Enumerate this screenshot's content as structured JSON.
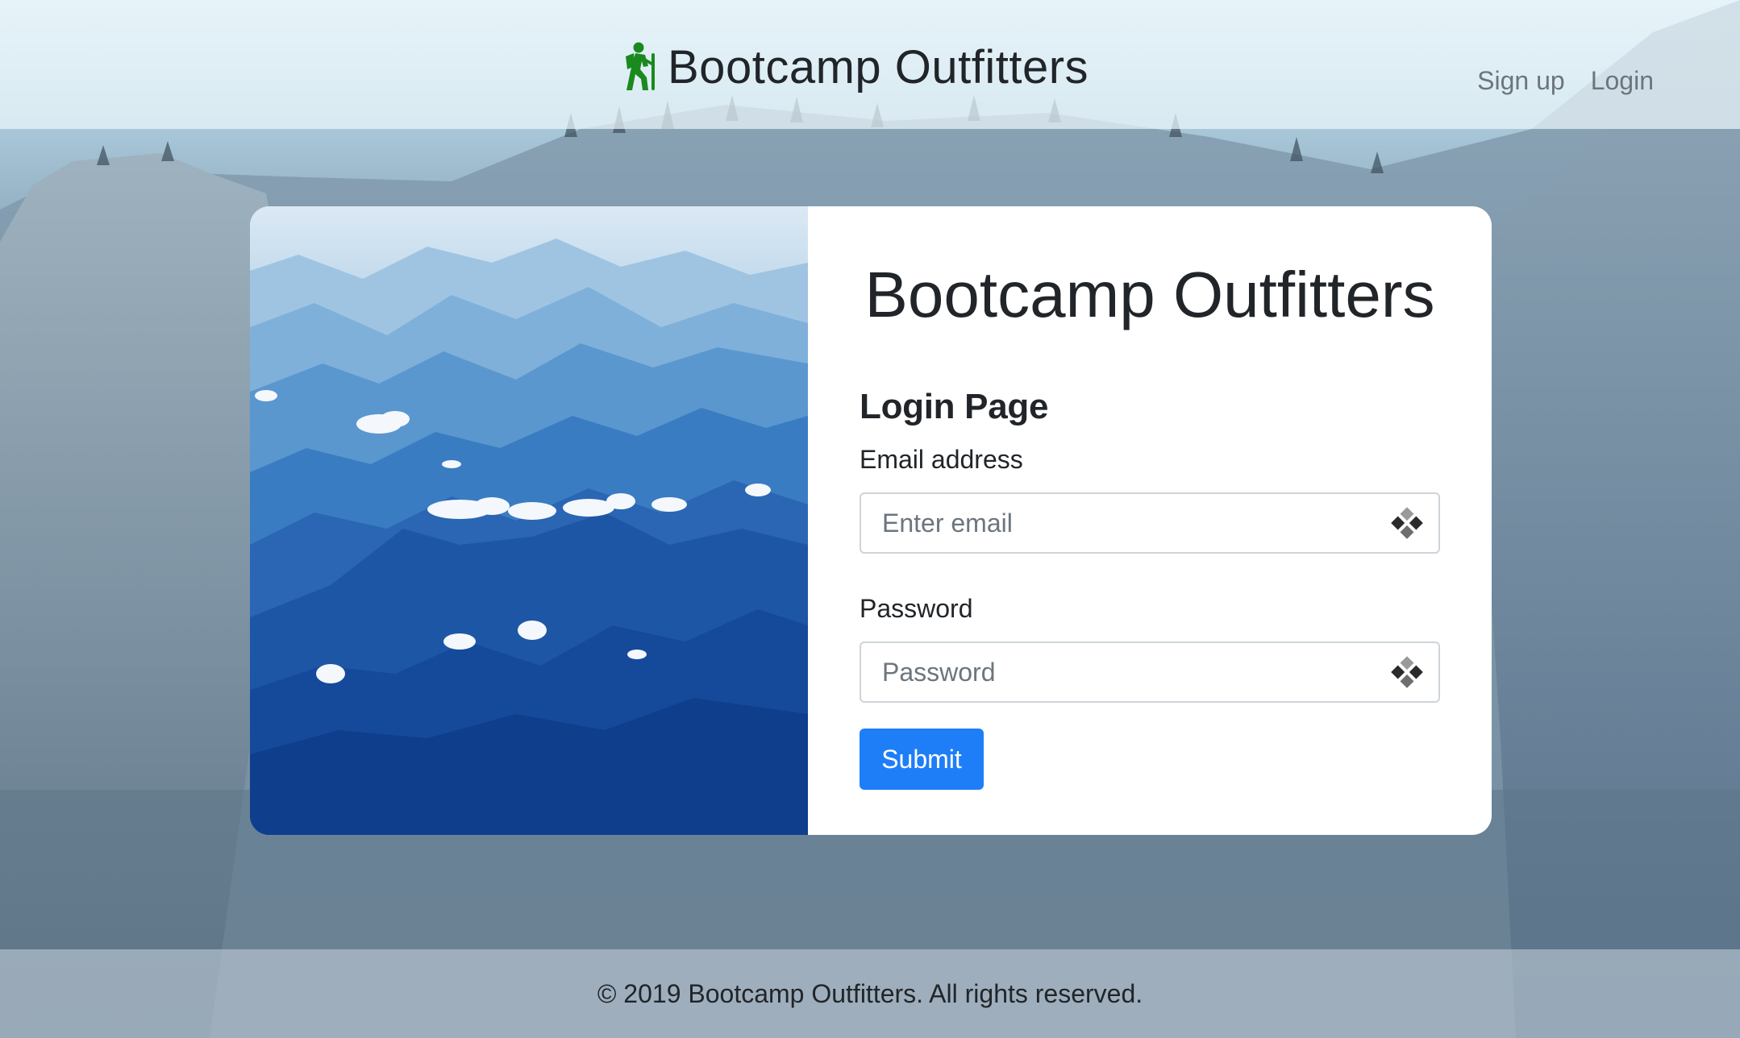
{
  "navbar": {
    "brand": "Bootcamp Outfitters",
    "brand_icon": "hiking-icon",
    "brand_icon_color": "#1a8a1f",
    "links": [
      "Sign up",
      "Login"
    ]
  },
  "card": {
    "title": "Bootcamp Outfitters",
    "form": {
      "heading": "Login Page",
      "email": {
        "label": "Email address",
        "placeholder": "Enter email",
        "icon": "password-manager-icon"
      },
      "password": {
        "label": "Password",
        "placeholder": "Password",
        "icon": "password-manager-icon"
      },
      "submit_label": "Submit"
    }
  },
  "footer": {
    "text": "© 2019 Bootcamp Outfitters. All rights reserved."
  },
  "colors": {
    "primary": "#1e7ef8",
    "text": "#212529",
    "muted": "#6c757d"
  }
}
